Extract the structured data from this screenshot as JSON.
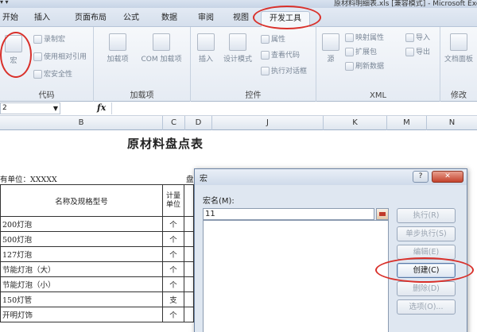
{
  "window": {
    "quick_access": "▾ ▾",
    "title": "原材料明细表.xls [兼容模式] - Microsoft Excel"
  },
  "ribbon_tabs": [
    {
      "label": "开始"
    },
    {
      "label": "插入"
    },
    {
      "label": "页面布局"
    },
    {
      "label": "公式"
    },
    {
      "label": "数据"
    },
    {
      "label": "审阅"
    },
    {
      "label": "视图"
    },
    {
      "label": "开发工具",
      "active": true
    }
  ],
  "ribbon": {
    "code": {
      "label": "代码",
      "vb": "",
      "macros": "宏",
      "record": "录制宏",
      "relative": "使用相对引用",
      "security": "宏安全性"
    },
    "addins": {
      "label": "加载项",
      "addins": "加载项",
      "com": "COM 加载项"
    },
    "controls": {
      "label": "控件",
      "insert": "插入",
      "design": "设计模式",
      "properties": "属性",
      "view_code": "查看代码",
      "dialog": "执行对话框"
    },
    "xml": {
      "label": "XML",
      "source": "源",
      "map_props": "映射属性",
      "expansion": "扩展包",
      "refresh": "刷新数据",
      "import": "导入",
      "export": "导出"
    },
    "modify": {
      "label": "修改",
      "doc_panel": "文档面板"
    }
  },
  "formula_bar": {
    "name_box": "2",
    "fx": "fx",
    "value": ""
  },
  "columns": [
    "B",
    "C",
    "D",
    "J",
    "K",
    "M",
    "N"
  ],
  "sheet": {
    "title": "原材料盘点表",
    "unit_label": "有单位：XXXXX",
    "unit_right": "盘",
    "header": {
      "name": "名称及规格型号",
      "unit": "计量单位"
    },
    "rows": [
      {
        "name": "200灯泡",
        "unit": "个"
      },
      {
        "name": "500灯泡",
        "unit": "个"
      },
      {
        "name": "127灯泡",
        "unit": "个"
      },
      {
        "name": "节能灯泡（大）",
        "unit": "个"
      },
      {
        "name": "节能灯泡（小）",
        "unit": "个"
      },
      {
        "name": "150灯管",
        "unit": "支"
      },
      {
        "name": "开明灯饰",
        "unit": "个"
      }
    ]
  },
  "dialog": {
    "title": "宏",
    "help": "?",
    "close": "✕",
    "macro_name_label": "宏名(M):",
    "macro_name_value": "11",
    "buttons": {
      "run": "执行(R)",
      "step": "单步执行(S)",
      "edit": "编辑(E)",
      "create": "创建(C)",
      "delete": "删除(D)",
      "options": "选项(O)..."
    }
  },
  "colors": {
    "highlight": "#d9302a",
    "ribbon_bg": "#e5ebf3",
    "dialog_bg": "#dfe7f1"
  }
}
